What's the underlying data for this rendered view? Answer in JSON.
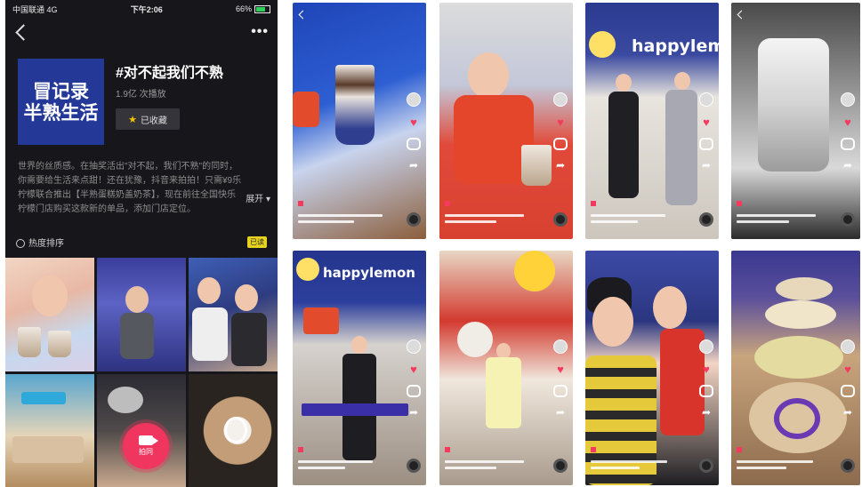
{
  "status_bar": {
    "carrier": "中国联通 4G",
    "time": "下午2:06",
    "battery": "66%"
  },
  "topic": {
    "cover_line1": "冒记录",
    "cover_line2": "半熟生活",
    "title": "#对不起我们不熟",
    "views": "1.9亿 次播放",
    "favorite_label": "已收藏"
  },
  "description": [
    "世界的丝质感。在抽奖活出\"对不起，我们不熟\"的同时，",
    "你需要给生活来点甜！还在犹豫，抖音来拍拍！只需¥9乐",
    "柠檬联合推出【半熟蛋糕奶盖奶茶】，现在前往全国快乐",
    "柠檬门店购买这款新的单品，添加门店定位。"
  ],
  "expand_label": "展开",
  "sort": {
    "label": "热度排序",
    "tag": "已读"
  },
  "camera_button_label": "拍同",
  "icons": {
    "back": "chevron-left-icon",
    "more": "more-dots-icon",
    "favorite": "star-icon",
    "sort": "clock-icon",
    "camera": "video-camera-icon"
  },
  "brand_text": "happylemon",
  "colors": {
    "accent_pink": "#f0355e",
    "cover_blue": "#243897",
    "star": "#f5c400",
    "tag_yellow": "#e7d21d"
  }
}
